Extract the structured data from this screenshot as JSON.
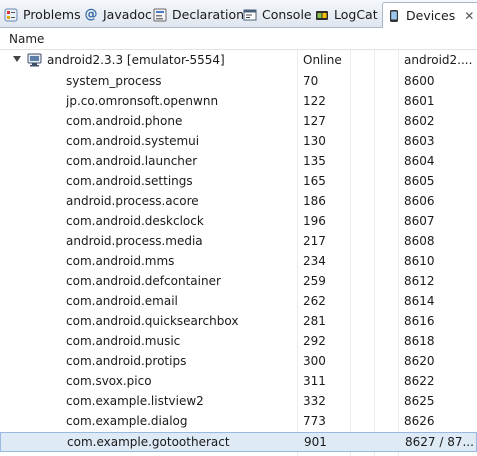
{
  "tabs": [
    {
      "label": "Problems",
      "icon": "problems-icon"
    },
    {
      "label": "Javadoc",
      "icon": "javadoc-icon"
    },
    {
      "label": "Declaration",
      "icon": "declaration-icon"
    },
    {
      "label": "Console",
      "icon": "console-icon"
    },
    {
      "label": "LogCat",
      "icon": "logcat-icon"
    },
    {
      "label": "Devices",
      "icon": "devices-icon",
      "active": true
    }
  ],
  "table": {
    "header": {
      "name": "Name"
    },
    "device": {
      "name": "android2.3.3 [emulator-5554]",
      "status": "Online",
      "target": "android2...."
    },
    "processes": [
      {
        "name": "system_process",
        "pid": "70",
        "port": "8600"
      },
      {
        "name": "jp.co.omronsoft.openwnn",
        "pid": "122",
        "port": "8601"
      },
      {
        "name": "com.android.phone",
        "pid": "127",
        "port": "8602"
      },
      {
        "name": "com.android.systemui",
        "pid": "130",
        "port": "8603"
      },
      {
        "name": "com.android.launcher",
        "pid": "135",
        "port": "8604"
      },
      {
        "name": "com.android.settings",
        "pid": "165",
        "port": "8605"
      },
      {
        "name": "android.process.acore",
        "pid": "186",
        "port": "8606"
      },
      {
        "name": "com.android.deskclock",
        "pid": "196",
        "port": "8607"
      },
      {
        "name": "android.process.media",
        "pid": "217",
        "port": "8608"
      },
      {
        "name": "com.android.mms",
        "pid": "234",
        "port": "8610"
      },
      {
        "name": "com.android.defcontainer",
        "pid": "259",
        "port": "8612"
      },
      {
        "name": "com.android.email",
        "pid": "262",
        "port": "8614"
      },
      {
        "name": "com.android.quicksearchbox",
        "pid": "281",
        "port": "8616"
      },
      {
        "name": "com.android.music",
        "pid": "292",
        "port": "8618"
      },
      {
        "name": "com.android.protips",
        "pid": "300",
        "port": "8620"
      },
      {
        "name": "com.svox.pico",
        "pid": "311",
        "port": "8622"
      },
      {
        "name": "com.example.listview2",
        "pid": "332",
        "port": "8625"
      },
      {
        "name": "com.example.dialog",
        "pid": "773",
        "port": "8626"
      },
      {
        "name": "com.example.gotootheract",
        "pid": "901",
        "port": "8627 / 87...",
        "selected": true
      }
    ]
  }
}
